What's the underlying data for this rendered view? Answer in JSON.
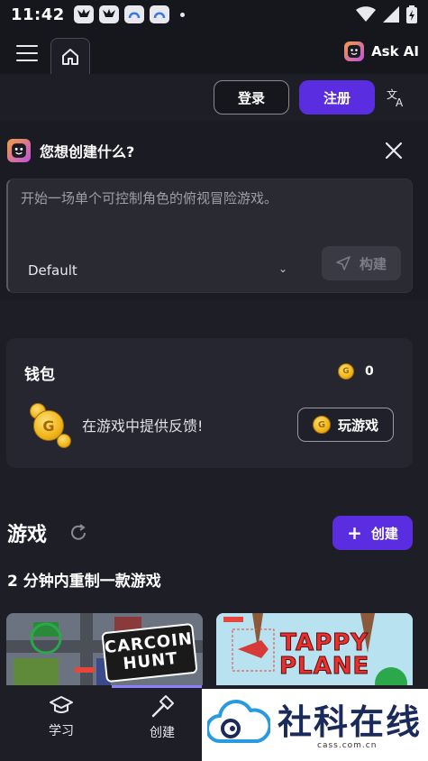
{
  "status_bar": {
    "time": "11:42"
  },
  "header": {
    "ask_ai_label": "Ask AI",
    "login_label": "登录",
    "register_label": "注册"
  },
  "prompt_panel": {
    "title": "您想创建什么?",
    "placeholder": "开始一场单个可控制角色的俯视冒险游戏。",
    "model": "Default",
    "build_label": "构建"
  },
  "wallet": {
    "title": "钱包",
    "balance": "0",
    "feedback_text": "在游戏中提供反馈!",
    "play_label": "玩游戏"
  },
  "games": {
    "title": "游戏",
    "create_label": "创建",
    "subtitle": "2 分钟内重制一款游戏",
    "cards": [
      {
        "name_line1": "CARCOIN",
        "name_line2": "HUNT"
      },
      {
        "name_line1": "TAPPY",
        "name_line2": "PLANE"
      }
    ]
  },
  "bottom_nav": {
    "learn_label": "学习",
    "create_label": "创建"
  },
  "watermark": {
    "title": "社科在线",
    "url": "cass.com.cn"
  },
  "colors": {
    "accent": "#5a2ee0",
    "background": "#1e1e27",
    "coin": "#f0b418"
  },
  "icons": [
    "hamburger-icon",
    "home-icon",
    "ai-face-icon",
    "translate-icon",
    "close-icon",
    "send-icon",
    "coin-icon",
    "refresh-icon",
    "plus-icon",
    "graduation-cap-icon",
    "hammer-icon"
  ]
}
